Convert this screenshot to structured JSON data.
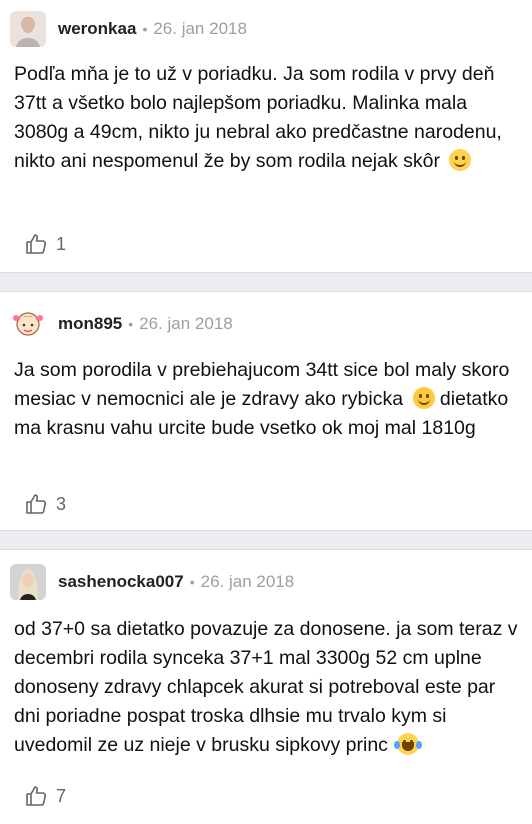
{
  "comments": [
    {
      "username": "weronkaa",
      "separator": "•",
      "date": "26. jan 2018",
      "text": "Podľa mňa je to už v poriadku. Ja som rodila v prvy deň 37tt a všetko bolo najlepšom poriadku. Malinka mala 3080g a 49cm, nikto ju nebral ako predčastne narodenu, nikto ani nespomenul že by som rodila nejak skôr",
      "emoji": "slightly-smiling-face",
      "likes": "1"
    },
    {
      "username": "mon895",
      "separator": "•",
      "date": "26. jan 2018",
      "text": "Ja som porodila v prebiehajucom 34tt sice bol maly skoro mesiac v nemocnici ale je zdravy ako rybicka",
      "emoji": "smiling-face-with-smiling-eyes",
      "text2": "dietatko ma krasnu vahu urcite bude vsetko ok moj mal 1810g",
      "likes": "3"
    },
    {
      "username": "sashenocka007",
      "separator": "•",
      "date": "26. jan 2018",
      "text": "od 37+0 sa dietatko povazuje za donosene. ja som teraz v decembri rodila synceka 37+1 mal 3300g 52 cm uplne donoseny zdravy chlapcek akurat si potreboval este par dni poriadne pospat troska dlhsie mu trvalo kym si uvedomil ze uz nieje v brusku sipkovy princ",
      "emoji": "face-with-tears-of-joy",
      "likes": "7"
    }
  ]
}
